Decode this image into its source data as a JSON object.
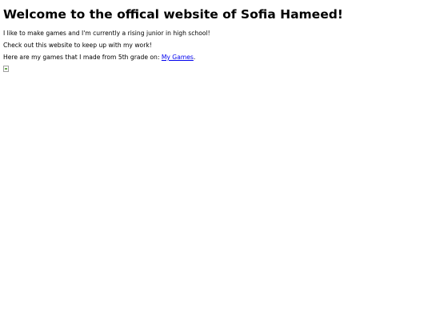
{
  "page": {
    "heading": "Welcome to the offical website of Sofia Hameed!",
    "intro": "I like to make games and I'm currently a rising junior in high school!",
    "check_out": "Check out this website to keep up with my work!",
    "games_prefix": "Here are my games that I made from 5th grade on: ",
    "games_link": "My Games",
    "games_suffix": ".",
    "link_color": "#0000ee"
  }
}
